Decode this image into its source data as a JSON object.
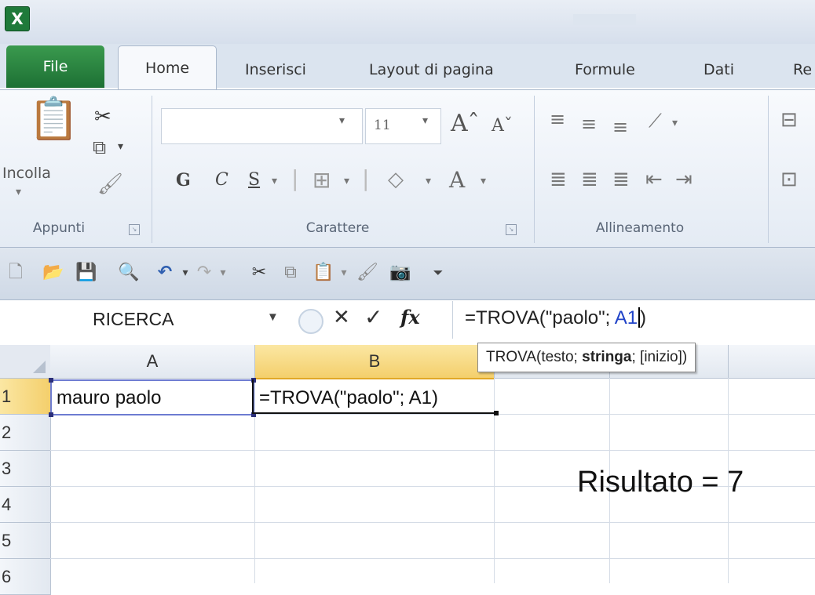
{
  "app": {
    "icon_letter": "X"
  },
  "tabs": [
    {
      "label": "File"
    },
    {
      "label": "Home"
    },
    {
      "label": "Inserisci"
    },
    {
      "label": "Layout di pagina"
    },
    {
      "label": "Formule"
    },
    {
      "label": "Dati"
    },
    {
      "label": "Re"
    }
  ],
  "ribbon": {
    "clipboard": {
      "paste_label": "Incolla",
      "group_label": "Appunti"
    },
    "font": {
      "name_value": "",
      "size_value": "11",
      "grow_label": "Aˆ",
      "shrink_label": "Aˇ",
      "bold_label": "G",
      "italic_label": "C",
      "underline_label": "S",
      "color_label": "A",
      "group_label": "Carattere"
    },
    "alignment": {
      "group_label": "Allineamento"
    }
  },
  "formula_bar": {
    "name_box": "RICERCA",
    "fx_label": "fx",
    "formula_prefix": "=TROVA(\"paolo\"; ",
    "formula_ref": "A1",
    "formula_suffix": ")"
  },
  "grid": {
    "columns": [
      "A",
      "B"
    ],
    "rows": [
      "1",
      "2",
      "3",
      "4",
      "5",
      "6"
    ],
    "selected_column": "B",
    "selected_row": "1",
    "cells": {
      "A1": "mauro paolo",
      "B1": "=TROVA(\"paolo\"; A1)"
    }
  },
  "tooltip": {
    "prefix": "TROVA(testo; ",
    "bold": "stringa",
    "suffix": "; [inizio])"
  },
  "annotation": {
    "result": "Risultato = 7"
  }
}
